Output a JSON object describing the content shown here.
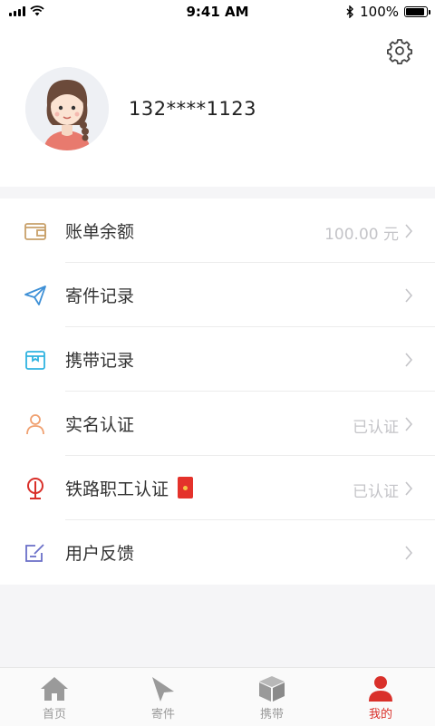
{
  "status_bar": {
    "time": "9:41 AM",
    "battery_percent": "100%"
  },
  "profile": {
    "phone": "132****1123"
  },
  "menu": [
    {
      "id": "bill",
      "label": "账单余额",
      "value": "100.00 元",
      "icon": "wallet-icon"
    },
    {
      "id": "send",
      "label": "寄件记录",
      "value": "",
      "icon": "paper-plane-icon"
    },
    {
      "id": "carry",
      "label": "携带记录",
      "value": "",
      "icon": "package-icon"
    },
    {
      "id": "realname",
      "label": "实名认证",
      "value": "已认证",
      "icon": "user-icon"
    },
    {
      "id": "railway",
      "label": "铁路职工认证",
      "value": "已认证",
      "icon": "railway-logo-icon"
    },
    {
      "id": "feedback",
      "label": "用户反馈",
      "value": "",
      "icon": "edit-icon"
    }
  ],
  "tabbar": [
    {
      "label": "首页",
      "icon": "home-icon",
      "active": false
    },
    {
      "label": "寄件",
      "icon": "send-icon",
      "active": false
    },
    {
      "label": "携带",
      "icon": "box-icon",
      "active": false
    },
    {
      "label": "我的",
      "icon": "profile-icon",
      "active": true
    }
  ],
  "colors": {
    "accent": "#d9302a",
    "inactive": "#9a9a9a",
    "wallet": "#c8a06a",
    "send": "#3d8fd6",
    "carry": "#2fb3e0",
    "realname": "#f0a070",
    "railway": "#d9302a",
    "feedback": "#6a6fc8"
  }
}
